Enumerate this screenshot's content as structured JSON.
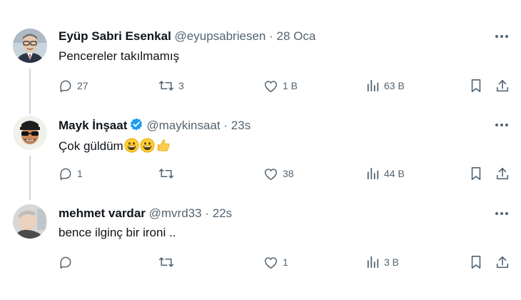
{
  "tweets": [
    {
      "name": "Eyüp Sabri Esenkal",
      "handle": "@eyupsabriesen",
      "separator": "·",
      "time": "28 Oca",
      "text": "Pencereler takılmamış",
      "replies": "27",
      "retweets": "3",
      "likes": "1 B",
      "views": "63 B",
      "verified": false,
      "avatar_icon": "profile-photo-older-man-glasses"
    },
    {
      "name": "Mayk İnşaat",
      "handle": "@maykinsaat",
      "separator": "·",
      "time": "23s",
      "text": "Çok güldüm",
      "emojis": [
        "grinning-face-icon",
        "grinning-face-icon",
        "thumbs-up-icon"
      ],
      "replies": "1",
      "retweets": "",
      "likes": "38",
      "views": "44 B",
      "verified": true,
      "verified_color": "#1d9bf0",
      "avatar_icon": "cartoon-avatar-sunglasses"
    },
    {
      "name": "mehmet vardar",
      "handle": "@mvrd33",
      "separator": "·",
      "time": "22s",
      "text": "bence ilginç bir ironi ..",
      "replies": "",
      "retweets": "",
      "likes": "1",
      "views": "3 B",
      "verified": false,
      "avatar_icon": "profile-photo-man"
    }
  ],
  "colors": {
    "text": "#0f1419",
    "secondary": "#536471",
    "thread_line": "#cfd9de",
    "verified": "#1d9bf0"
  }
}
